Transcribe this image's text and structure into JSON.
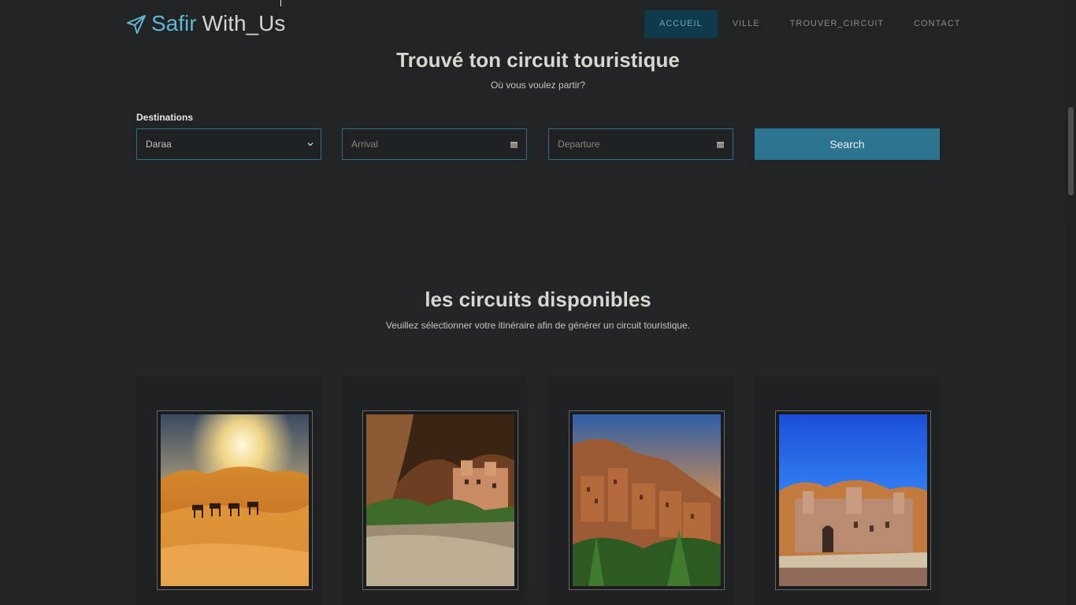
{
  "brand": {
    "part1": "Safir",
    "part2": "With_Us",
    "icon": "paper-plane-icon"
  },
  "nav": [
    {
      "label": "ACCUEIL",
      "active": true
    },
    {
      "label": "VILLE",
      "active": false
    },
    {
      "label": "TROUVER_CIRCUIT",
      "active": false
    },
    {
      "label": "CONTACT",
      "active": false
    }
  ],
  "hero": {
    "title": "Trouvé ton circuit touristique",
    "subtitle": "Où vous voulez partir?"
  },
  "form": {
    "destinations_label": "Destinations",
    "destination_value": "Daraa",
    "arrival_placeholder": "Arrival",
    "departure_placeholder": "Departure",
    "search_label": "Search"
  },
  "circuits": {
    "title": "les circuits disponibles",
    "subtitle": "Veuillez sélectionner votre itinéraire afin de générer un circuit touristique.",
    "cards": [
      {
        "image": "desert-camels-sunset-image"
      },
      {
        "image": "gorge-village-image"
      },
      {
        "image": "kasbah-sunset-image"
      },
      {
        "image": "palace-blue-sky-image"
      }
    ]
  },
  "colors": {
    "accent": "#2b7590",
    "brand": "#5fb7d4",
    "nav_active_bg": "#0e3a4b",
    "background": "#222426"
  }
}
